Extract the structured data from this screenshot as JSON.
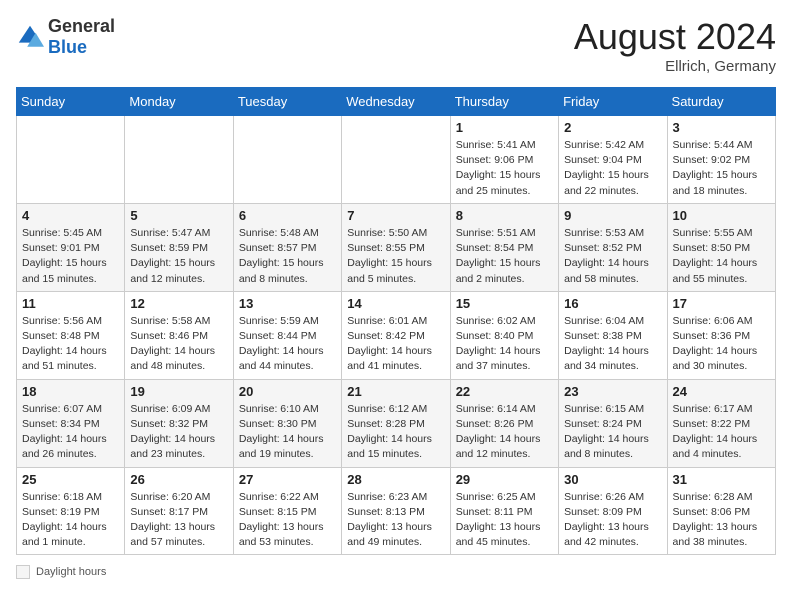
{
  "header": {
    "logo_general": "General",
    "logo_blue": "Blue",
    "month_year": "August 2024",
    "location": "Ellrich, Germany"
  },
  "days_of_week": [
    "Sunday",
    "Monday",
    "Tuesday",
    "Wednesday",
    "Thursday",
    "Friday",
    "Saturday"
  ],
  "weeks": [
    [
      {
        "day": "",
        "info": ""
      },
      {
        "day": "",
        "info": ""
      },
      {
        "day": "",
        "info": ""
      },
      {
        "day": "",
        "info": ""
      },
      {
        "day": "1",
        "info": "Sunrise: 5:41 AM\nSunset: 9:06 PM\nDaylight: 15 hours and 25 minutes."
      },
      {
        "day": "2",
        "info": "Sunrise: 5:42 AM\nSunset: 9:04 PM\nDaylight: 15 hours and 22 minutes."
      },
      {
        "day": "3",
        "info": "Sunrise: 5:44 AM\nSunset: 9:02 PM\nDaylight: 15 hours and 18 minutes."
      }
    ],
    [
      {
        "day": "4",
        "info": "Sunrise: 5:45 AM\nSunset: 9:01 PM\nDaylight: 15 hours and 15 minutes."
      },
      {
        "day": "5",
        "info": "Sunrise: 5:47 AM\nSunset: 8:59 PM\nDaylight: 15 hours and 12 minutes."
      },
      {
        "day": "6",
        "info": "Sunrise: 5:48 AM\nSunset: 8:57 PM\nDaylight: 15 hours and 8 minutes."
      },
      {
        "day": "7",
        "info": "Sunrise: 5:50 AM\nSunset: 8:55 PM\nDaylight: 15 hours and 5 minutes."
      },
      {
        "day": "8",
        "info": "Sunrise: 5:51 AM\nSunset: 8:54 PM\nDaylight: 15 hours and 2 minutes."
      },
      {
        "day": "9",
        "info": "Sunrise: 5:53 AM\nSunset: 8:52 PM\nDaylight: 14 hours and 58 minutes."
      },
      {
        "day": "10",
        "info": "Sunrise: 5:55 AM\nSunset: 8:50 PM\nDaylight: 14 hours and 55 minutes."
      }
    ],
    [
      {
        "day": "11",
        "info": "Sunrise: 5:56 AM\nSunset: 8:48 PM\nDaylight: 14 hours and 51 minutes."
      },
      {
        "day": "12",
        "info": "Sunrise: 5:58 AM\nSunset: 8:46 PM\nDaylight: 14 hours and 48 minutes."
      },
      {
        "day": "13",
        "info": "Sunrise: 5:59 AM\nSunset: 8:44 PM\nDaylight: 14 hours and 44 minutes."
      },
      {
        "day": "14",
        "info": "Sunrise: 6:01 AM\nSunset: 8:42 PM\nDaylight: 14 hours and 41 minutes."
      },
      {
        "day": "15",
        "info": "Sunrise: 6:02 AM\nSunset: 8:40 PM\nDaylight: 14 hours and 37 minutes."
      },
      {
        "day": "16",
        "info": "Sunrise: 6:04 AM\nSunset: 8:38 PM\nDaylight: 14 hours and 34 minutes."
      },
      {
        "day": "17",
        "info": "Sunrise: 6:06 AM\nSunset: 8:36 PM\nDaylight: 14 hours and 30 minutes."
      }
    ],
    [
      {
        "day": "18",
        "info": "Sunrise: 6:07 AM\nSunset: 8:34 PM\nDaylight: 14 hours and 26 minutes."
      },
      {
        "day": "19",
        "info": "Sunrise: 6:09 AM\nSunset: 8:32 PM\nDaylight: 14 hours and 23 minutes."
      },
      {
        "day": "20",
        "info": "Sunrise: 6:10 AM\nSunset: 8:30 PM\nDaylight: 14 hours and 19 minutes."
      },
      {
        "day": "21",
        "info": "Sunrise: 6:12 AM\nSunset: 8:28 PM\nDaylight: 14 hours and 15 minutes."
      },
      {
        "day": "22",
        "info": "Sunrise: 6:14 AM\nSunset: 8:26 PM\nDaylight: 14 hours and 12 minutes."
      },
      {
        "day": "23",
        "info": "Sunrise: 6:15 AM\nSunset: 8:24 PM\nDaylight: 14 hours and 8 minutes."
      },
      {
        "day": "24",
        "info": "Sunrise: 6:17 AM\nSunset: 8:22 PM\nDaylight: 14 hours and 4 minutes."
      }
    ],
    [
      {
        "day": "25",
        "info": "Sunrise: 6:18 AM\nSunset: 8:19 PM\nDaylight: 14 hours and 1 minute."
      },
      {
        "day": "26",
        "info": "Sunrise: 6:20 AM\nSunset: 8:17 PM\nDaylight: 13 hours and 57 minutes."
      },
      {
        "day": "27",
        "info": "Sunrise: 6:22 AM\nSunset: 8:15 PM\nDaylight: 13 hours and 53 minutes."
      },
      {
        "day": "28",
        "info": "Sunrise: 6:23 AM\nSunset: 8:13 PM\nDaylight: 13 hours and 49 minutes."
      },
      {
        "day": "29",
        "info": "Sunrise: 6:25 AM\nSunset: 8:11 PM\nDaylight: 13 hours and 45 minutes."
      },
      {
        "day": "30",
        "info": "Sunrise: 6:26 AM\nSunset: 8:09 PM\nDaylight: 13 hours and 42 minutes."
      },
      {
        "day": "31",
        "info": "Sunrise: 6:28 AM\nSunset: 8:06 PM\nDaylight: 13 hours and 38 minutes."
      }
    ]
  ],
  "footer": {
    "daylight_label": "Daylight hours"
  }
}
